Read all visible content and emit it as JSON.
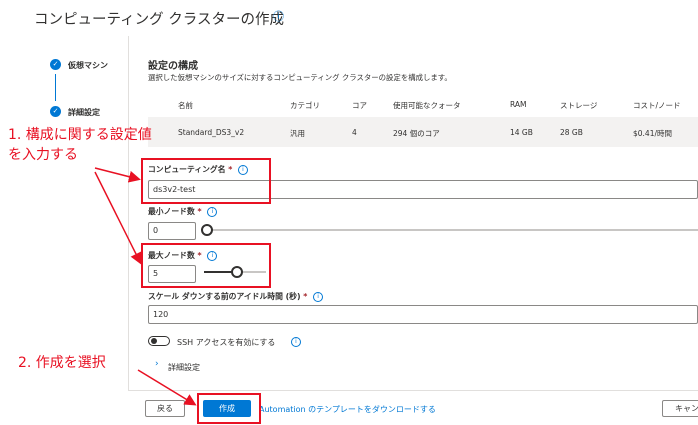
{
  "header": {
    "title": "コンピューティング クラスターの作成",
    "info_icon": "info-icon"
  },
  "steps": [
    {
      "label": "仮想マシン"
    },
    {
      "label": "詳細設定"
    }
  ],
  "section": {
    "title": "設定の構成",
    "description": "選択した仮想マシンのサイズに対するコンピューティング クラスターの設定を構成します。"
  },
  "table": {
    "headers": [
      "名前",
      "カテゴリ",
      "コア",
      "使用可能なクォータ",
      "RAM",
      "ストレージ",
      "コスト/ノード"
    ],
    "row": [
      "Standard_DS3_v2",
      "汎用",
      "4",
      "294 個のコア",
      "14 GB",
      "28 GB",
      "$0.41/時間"
    ]
  },
  "form": {
    "compute_name": {
      "label": "コンピューティング名",
      "required": "*",
      "value": "ds3v2-test"
    },
    "min_nodes": {
      "label": "最小ノード数",
      "required": "*",
      "value": "0",
      "level": 0
    },
    "max_nodes": {
      "label": "最大ノード数",
      "required": "*",
      "value": "5",
      "level": 0.5
    },
    "idle": {
      "label": "スケール ダウンする前のアイドル時間 (秒)",
      "required": "*",
      "value": "120"
    },
    "ssh_label": "SSH アクセスを有効にする",
    "advanced_label": "詳細設定"
  },
  "footer": {
    "back": "戻る",
    "create": "作成",
    "template_link": "Automation のテンプレートをダウンロードする",
    "cancel": "キャン"
  },
  "annotations": {
    "note1_line1": "1. 構成に関する設定値",
    "note1_line2": "を入力する",
    "note2": "2. 作成を選択"
  },
  "colors": {
    "accent": "#0078d4",
    "annotation": "#e81123"
  }
}
